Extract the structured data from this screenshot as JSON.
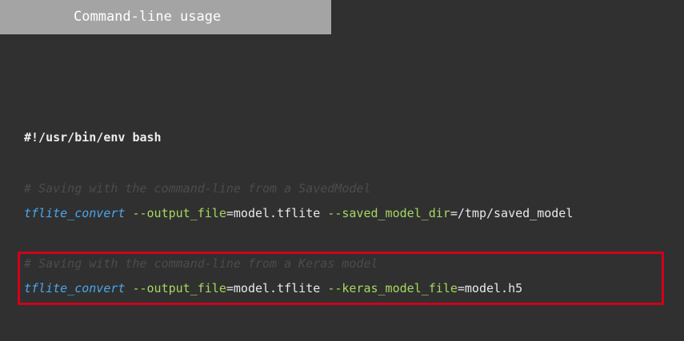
{
  "header": {
    "title": "Command-line usage"
  },
  "code": {
    "shebang": "#!/usr/bin/env bash",
    "block1": {
      "comment": "# Saving with the command-line from a SavedModel",
      "command": "tflite_convert",
      "flag1": "--output_file",
      "value1": "=model.tflite",
      "flag2": "--saved_model_dir",
      "value2": "=/tmp/saved_model"
    },
    "block2": {
      "comment": "# Saving with the command-line from a Keras model",
      "command": "tflite_convert",
      "flag1": "--output_file",
      "value1": "=model.tflite",
      "flag2": "--keras_model_file",
      "value2": "=model.h5"
    }
  },
  "colors": {
    "background": "#303030",
    "title_bar": "#a4a4a4",
    "command": "#4aa6ee",
    "flag": "#a6d860",
    "comment": "#4c4c4c",
    "highlight": "#d0021b"
  }
}
